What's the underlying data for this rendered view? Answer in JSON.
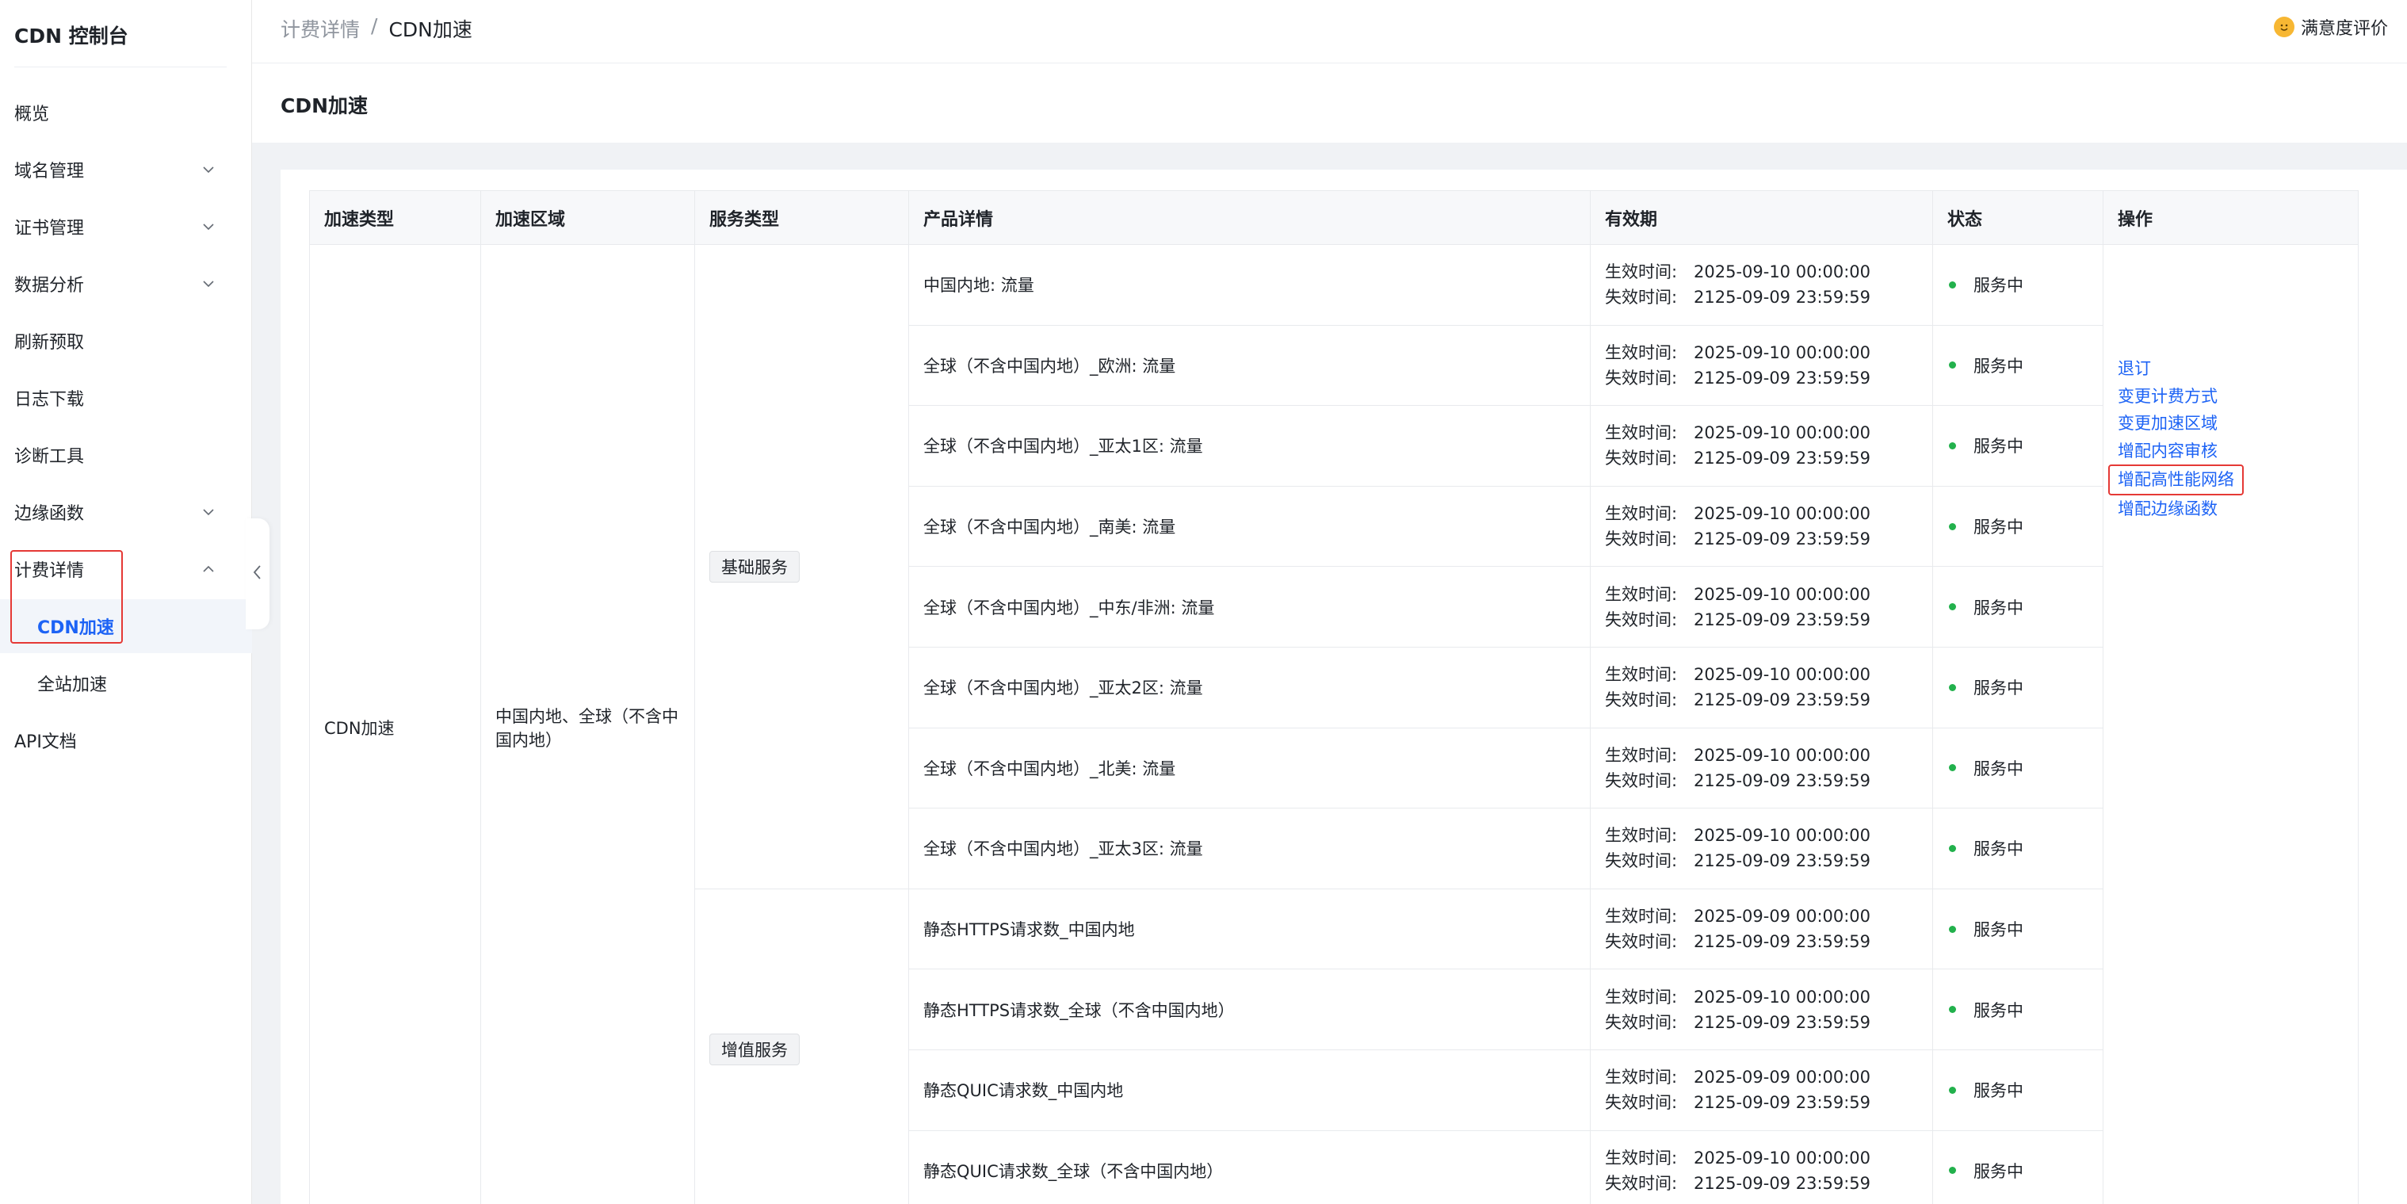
{
  "sidebar": {
    "brand": "CDN 控制台",
    "items": [
      {
        "label": "概览",
        "chevron": false
      },
      {
        "label": "域名管理",
        "chevron": "down"
      },
      {
        "label": "证书管理",
        "chevron": "down"
      },
      {
        "label": "数据分析",
        "chevron": "down"
      },
      {
        "label": "刷新预取",
        "chevron": false
      },
      {
        "label": "日志下载",
        "chevron": false
      },
      {
        "label": "诊断工具",
        "chevron": false
      },
      {
        "label": "边缘函数",
        "chevron": "down"
      },
      {
        "label": "计费详情",
        "chevron": "up"
      }
    ],
    "subitems": [
      {
        "label": "CDN加速",
        "active": true
      },
      {
        "label": "全站加速",
        "active": false
      }
    ],
    "bottom_item": "API文档"
  },
  "header": {
    "breadcrumb": [
      "计费详情",
      "/",
      "CDN加速"
    ],
    "rating_label": "满意度评价",
    "page_title": "CDN加速"
  },
  "table": {
    "columns": [
      "加速类型",
      "加速区域",
      "服务类型",
      "产品详情",
      "有效期",
      "状态",
      "操作"
    ],
    "accel_type": "CDN加速",
    "accel_region": "中国内地、全球（不含中国内地）",
    "service_groups": [
      "基础服务",
      "增值服务"
    ],
    "validity_labels": {
      "start": "生效时间:",
      "end": "失效时间:"
    },
    "status_text": "服务中",
    "rows": [
      {
        "product": "中国内地: 流量",
        "start": "2025-09-10 00:00:00",
        "end": "2125-09-09 23:59:59"
      },
      {
        "product": "全球（不含中国内地）_欧洲: 流量",
        "start": "2025-09-10 00:00:00",
        "end": "2125-09-09 23:59:59"
      },
      {
        "product": "全球（不含中国内地）_亚太1区: 流量",
        "start": "2025-09-10 00:00:00",
        "end": "2125-09-09 23:59:59"
      },
      {
        "product": "全球（不含中国内地）_南美: 流量",
        "start": "2025-09-10 00:00:00",
        "end": "2125-09-09 23:59:59"
      },
      {
        "product": "全球（不含中国内地）_中东/非洲: 流量",
        "start": "2025-09-10 00:00:00",
        "end": "2125-09-09 23:59:59"
      },
      {
        "product": "全球（不含中国内地）_亚太2区: 流量",
        "start": "2025-09-10 00:00:00",
        "end": "2125-09-09 23:59:59"
      },
      {
        "product": "全球（不含中国内地）_北美: 流量",
        "start": "2025-09-10 00:00:00",
        "end": "2125-09-09 23:59:59"
      },
      {
        "product": "全球（不含中国内地）_亚太3区: 流量",
        "start": "2025-09-10 00:00:00",
        "end": "2125-09-09 23:59:59"
      },
      {
        "product": "静态HTTPS请求数_中国内地",
        "start": "2025-09-09 00:00:00",
        "end": "2125-09-09 23:59:59"
      },
      {
        "product": "静态HTTPS请求数_全球（不含中国内地）",
        "start": "2025-09-10 00:00:00",
        "end": "2125-09-09 23:59:59"
      },
      {
        "product": "静态QUIC请求数_中国内地",
        "start": "2025-09-09 00:00:00",
        "end": "2125-09-09 23:59:59"
      },
      {
        "product": "静态QUIC请求数_全球（不含中国内地）",
        "start": "2025-09-10 00:00:00",
        "end": "2125-09-09 23:59:59"
      }
    ],
    "operations": [
      "退订",
      "变更计费方式",
      "变更加速区域",
      "增配内容审核",
      "增配高性能网络",
      "增配边缘函数"
    ]
  },
  "colors": {
    "accent": "#1d63f5",
    "status_dot": "#22b14c",
    "highlight": "#e53935"
  }
}
